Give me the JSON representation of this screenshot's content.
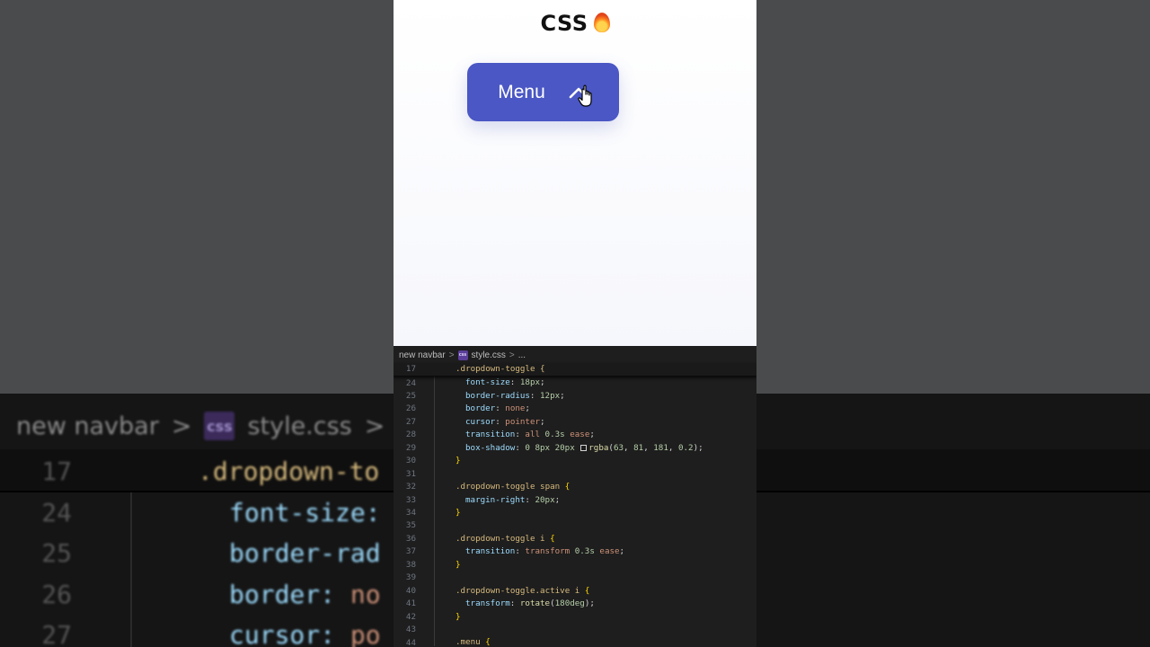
{
  "preview": {
    "title": "CSS",
    "button_label": "Menu",
    "button_color": "#4a57c4"
  },
  "editor": {
    "breadcrumb": {
      "folder": "new navbar",
      "file_icon_text": "css",
      "file": "style.css",
      "ellipsis": "..."
    },
    "sticky": {
      "num": "17",
      "text": ".dropdown-toggle {"
    },
    "lines": [
      {
        "num": "24",
        "indent": 1,
        "tokens": [
          [
            "prop",
            "font-size"
          ],
          [
            "punct",
            ": "
          ],
          [
            "num",
            "18px"
          ],
          [
            "punct",
            ";"
          ]
        ]
      },
      {
        "num": "25",
        "indent": 1,
        "tokens": [
          [
            "prop",
            "border-radius"
          ],
          [
            "punct",
            ": "
          ],
          [
            "num",
            "12px"
          ],
          [
            "punct",
            ";"
          ]
        ]
      },
      {
        "num": "26",
        "indent": 1,
        "tokens": [
          [
            "prop",
            "border"
          ],
          [
            "punct",
            ": "
          ],
          [
            "val",
            "none"
          ],
          [
            "punct",
            ";"
          ]
        ]
      },
      {
        "num": "27",
        "indent": 1,
        "tokens": [
          [
            "prop",
            "cursor"
          ],
          [
            "punct",
            ": "
          ],
          [
            "val",
            "pointer"
          ],
          [
            "punct",
            ";"
          ]
        ]
      },
      {
        "num": "28",
        "indent": 1,
        "tokens": [
          [
            "prop",
            "transition"
          ],
          [
            "punct",
            ": "
          ],
          [
            "val",
            "all "
          ],
          [
            "num",
            "0.3s"
          ],
          [
            "val",
            " ease"
          ],
          [
            "punct",
            ";"
          ]
        ]
      },
      {
        "num": "29",
        "indent": 1,
        "tokens": [
          [
            "prop",
            "box-shadow"
          ],
          [
            "punct",
            ": "
          ],
          [
            "num",
            "0 8px 20px "
          ],
          [
            "swatch",
            ""
          ],
          [
            "fn",
            "rgba"
          ],
          [
            "punct",
            "("
          ],
          [
            "num",
            "63"
          ],
          [
            "punct",
            ", "
          ],
          [
            "num",
            "81"
          ],
          [
            "punct",
            ", "
          ],
          [
            "num",
            "181"
          ],
          [
            "punct",
            ", "
          ],
          [
            "num",
            "0.2"
          ],
          [
            "punct",
            ");"
          ]
        ]
      },
      {
        "num": "30",
        "indent": 0,
        "tokens": [
          [
            "brace",
            "}"
          ]
        ]
      },
      {
        "num": "31",
        "indent": 0,
        "tokens": []
      },
      {
        "num": "32",
        "indent": 0,
        "tokens": [
          [
            "sel",
            ".dropdown-toggle span "
          ],
          [
            "brace",
            "{"
          ]
        ]
      },
      {
        "num": "33",
        "indent": 1,
        "tokens": [
          [
            "prop",
            "margin-right"
          ],
          [
            "punct",
            ": "
          ],
          [
            "num",
            "20px"
          ],
          [
            "punct",
            ";"
          ]
        ]
      },
      {
        "num": "34",
        "indent": 0,
        "tokens": [
          [
            "brace",
            "}"
          ]
        ]
      },
      {
        "num": "35",
        "indent": 0,
        "tokens": []
      },
      {
        "num": "36",
        "indent": 0,
        "tokens": [
          [
            "sel",
            ".dropdown-toggle i "
          ],
          [
            "brace",
            "{"
          ]
        ]
      },
      {
        "num": "37",
        "indent": 1,
        "tokens": [
          [
            "prop",
            "transition"
          ],
          [
            "punct",
            ": "
          ],
          [
            "val",
            "transform "
          ],
          [
            "num",
            "0.3s"
          ],
          [
            "val",
            " ease"
          ],
          [
            "punct",
            ";"
          ]
        ]
      },
      {
        "num": "38",
        "indent": 0,
        "tokens": [
          [
            "brace",
            "}"
          ]
        ]
      },
      {
        "num": "39",
        "indent": 0,
        "tokens": []
      },
      {
        "num": "40",
        "indent": 0,
        "tokens": [
          [
            "sel",
            ".dropdown-toggle.active i "
          ],
          [
            "brace",
            "{"
          ]
        ]
      },
      {
        "num": "41",
        "indent": 1,
        "tokens": [
          [
            "prop",
            "transform"
          ],
          [
            "punct",
            ": "
          ],
          [
            "fn",
            "rotate"
          ],
          [
            "punct",
            "("
          ],
          [
            "num",
            "180deg"
          ],
          [
            "punct",
            ");"
          ]
        ]
      },
      {
        "num": "42",
        "indent": 0,
        "tokens": [
          [
            "brace",
            "}"
          ]
        ]
      },
      {
        "num": "43",
        "indent": 0,
        "tokens": []
      },
      {
        "num": "44",
        "indent": 0,
        "tokens": [
          [
            "sel",
            ".menu "
          ],
          [
            "brace",
            "{"
          ]
        ]
      }
    ]
  },
  "background": {
    "breadcrumb": {
      "folder": "new navbar",
      "file_icon_text": "css",
      "file": "style.css",
      "ellipsis": "..."
    },
    "sticky": {
      "num": "17",
      "text": ".dropdown-to"
    },
    "lines": [
      {
        "num": "24",
        "prop": "font-size:",
        "val": ""
      },
      {
        "num": "25",
        "prop": "border-rad",
        "val": ""
      },
      {
        "num": "26",
        "prop": "border: ",
        "val": "no"
      },
      {
        "num": "27",
        "prop": "cursor: ",
        "val": "po"
      }
    ]
  }
}
